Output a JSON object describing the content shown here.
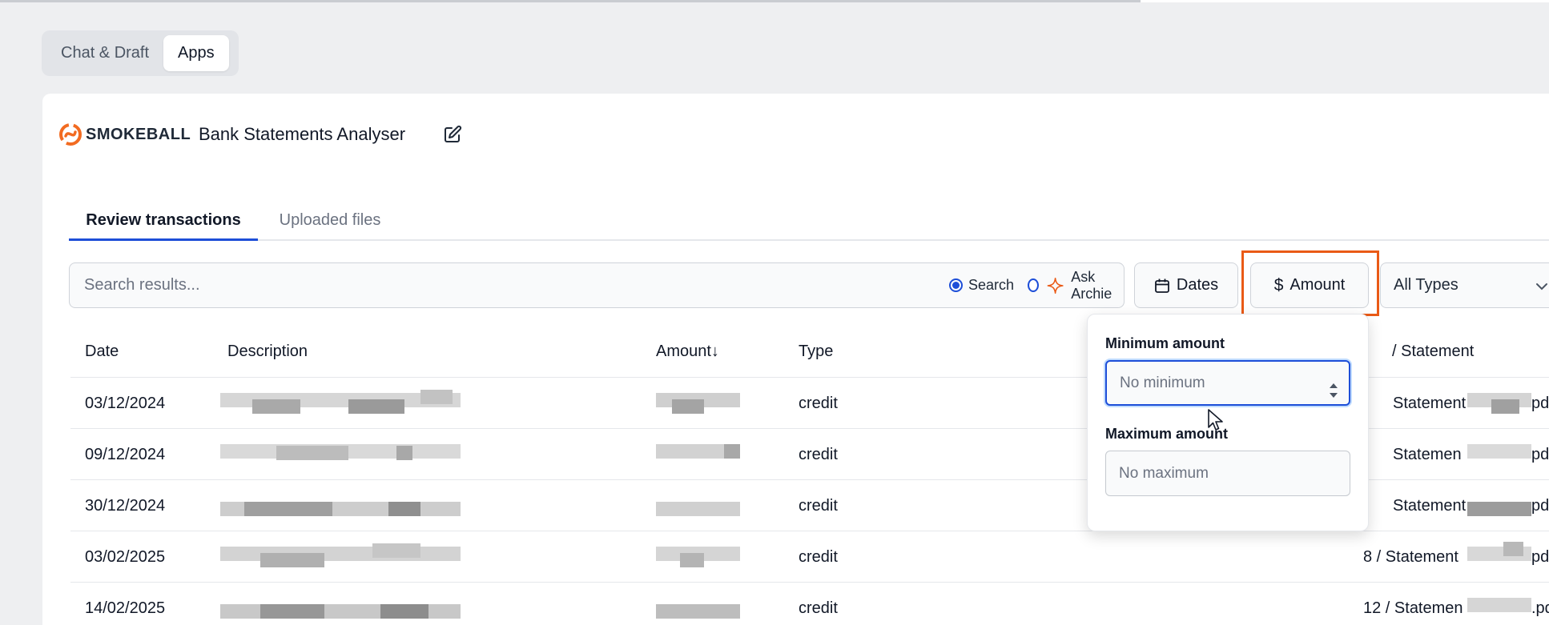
{
  "top_tabs": {
    "chat": "Chat & Draft",
    "apps": "Apps"
  },
  "header": {
    "brand": "SMOKEBALL",
    "title": "Bank Statements Analyser"
  },
  "tabs": {
    "review": "Review transactions",
    "uploaded": "Uploaded files"
  },
  "search": {
    "placeholder": "Search results...",
    "mode_search": "Search",
    "mode_ask": "Ask Archie",
    "selected_mode": "Search"
  },
  "filters": {
    "dates": "Dates",
    "amount": "Amount",
    "types": "All Types"
  },
  "table": {
    "headers": {
      "date": "Date",
      "description": "Description",
      "amount": "Amount↓",
      "type": "Type",
      "statement": "/ Statement"
    },
    "rows": [
      {
        "date": "03/12/2024",
        "type": "credit",
        "statement_prefix": "Statement",
        "statement_suffix": "pdf"
      },
      {
        "date": "09/12/2024",
        "type": "credit",
        "statement_prefix": "Statemen",
        "statement_suffix": "pdf"
      },
      {
        "date": "30/12/2024",
        "type": "credit",
        "statement_prefix": "Statement",
        "statement_suffix": "pdf"
      },
      {
        "date": "03/02/2025",
        "type": "credit",
        "statement_prefix": "8 / Statement",
        "statement_suffix": "pdf"
      },
      {
        "date": "14/02/2025",
        "type": "credit",
        "statement_prefix": "12 / Statemen",
        "statement_suffix": ".pdf"
      }
    ]
  },
  "amount_popover": {
    "min_label": "Minimum amount",
    "min_placeholder": "No minimum",
    "max_label": "Maximum amount",
    "max_placeholder": "No maximum"
  },
  "colors": {
    "accent": "#1d4ed8",
    "highlight": "#ea5a16",
    "brand": "#f26b21"
  }
}
